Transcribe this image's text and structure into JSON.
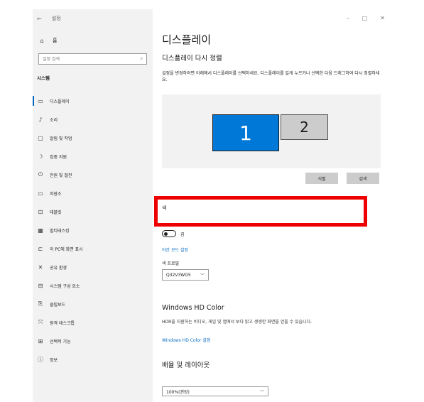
{
  "titlebar": {
    "back_glyph": "←",
    "app_title": "설정",
    "minimize": "–",
    "maximize": "□",
    "close": "✕"
  },
  "sidebar": {
    "home_label": "홈",
    "search_placeholder": "설정 검색",
    "section": "시스템",
    "items": [
      {
        "icon": "monitor-icon",
        "glyph": "▭",
        "label": "디스플레이",
        "selected": true
      },
      {
        "icon": "sound-icon",
        "glyph": "♪",
        "label": "소리"
      },
      {
        "icon": "notification-icon",
        "glyph": "▢",
        "label": "알림 및 작업"
      },
      {
        "icon": "focus-assist-icon",
        "glyph": "☽",
        "label": "집중 지원"
      },
      {
        "icon": "power-icon",
        "glyph": "⏻",
        "label": "전원 및 절전"
      },
      {
        "icon": "storage-icon",
        "glyph": "▭",
        "label": "저장소"
      },
      {
        "icon": "tablet-icon",
        "glyph": "⊡",
        "label": "태블릿"
      },
      {
        "icon": "multitasking-icon",
        "glyph": "▦",
        "label": "멀티태스킹"
      },
      {
        "icon": "projecting-icon",
        "glyph": "⊏",
        "label": "이 PC에 화면 표시"
      },
      {
        "icon": "shared-experiences-icon",
        "glyph": "✕",
        "label": "공유 환경"
      },
      {
        "icon": "system-components-icon",
        "glyph": "⊟",
        "label": "시스템 구성 요소"
      },
      {
        "icon": "clipboard-icon",
        "glyph": "⎘",
        "label": "클립보드"
      },
      {
        "icon": "remote-desktop-icon",
        "glyph": "⤧",
        "label": "원격 데스크톱"
      },
      {
        "icon": "optional-features-icon",
        "glyph": "⊞",
        "label": "선택적 기능"
      },
      {
        "icon": "about-icon",
        "glyph": "ⓘ",
        "label": "정보"
      }
    ]
  },
  "content": {
    "page_title": "디스플레이",
    "rearrange_title": "디스플레이 다시 정렬",
    "rearrange_desc": "설정을 변경하려면 아래에서 디스플레이를 선택하세요. 디스플레이를 길게 누르거나 선택한 다음 드래그하여 다시 정렬하세요.",
    "monitor_1": "1",
    "monitor_2": "2",
    "identify_button": "식별",
    "detect_button": "검색",
    "highlight_text": "색",
    "night_light_state": "끔",
    "night_light_link": "야간 모드 설정",
    "color_profile_label": "색 프로필",
    "color_profile_value": "Q32V3WG5",
    "hd_color_title": "Windows HD Color",
    "hd_color_desc": "HDR을 지원하는 비디오, 게임 및 앱에서 보다 밝고 생생한 화면을 얻을 수 있습니다.",
    "hd_color_link": "Windows HD Color 설정",
    "scale_title": "배율 및 레이아웃",
    "scale_value": "100%(권장)"
  },
  "colors": {
    "accent": "#0067c0",
    "monitor_selected": "#0078d7",
    "highlight": "#ee0000"
  }
}
